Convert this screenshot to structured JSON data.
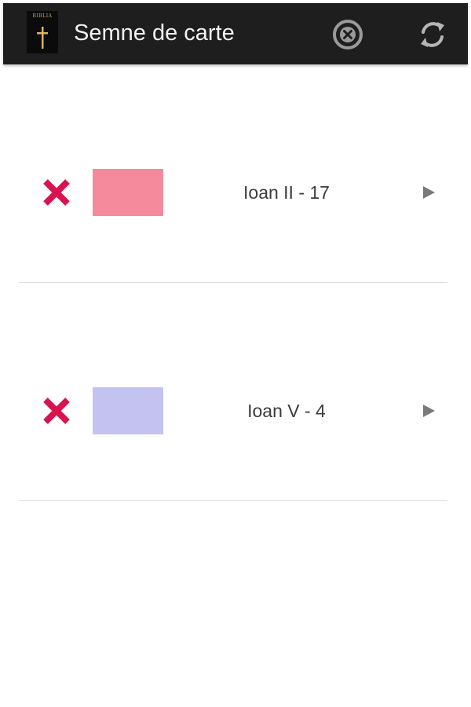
{
  "action_bar": {
    "logo_text": "BIBLIA",
    "title": "Semne de carte",
    "clear_icon": "clear-circle-icon",
    "refresh_icon": "refresh-icon",
    "background": "#1e1e1e"
  },
  "bookmarks": [
    {
      "reference": "Ioan II - 17",
      "color": "#f48a9c",
      "delete_icon": "delete-x-icon",
      "open_icon": "play-arrow-icon"
    },
    {
      "reference": "Ioan V - 4",
      "color": "#c4c2f0",
      "delete_icon": "delete-x-icon",
      "open_icon": "play-arrow-icon"
    }
  ],
  "colors": {
    "delete": "#d8144f",
    "arrow": "#7a7a7a"
  }
}
